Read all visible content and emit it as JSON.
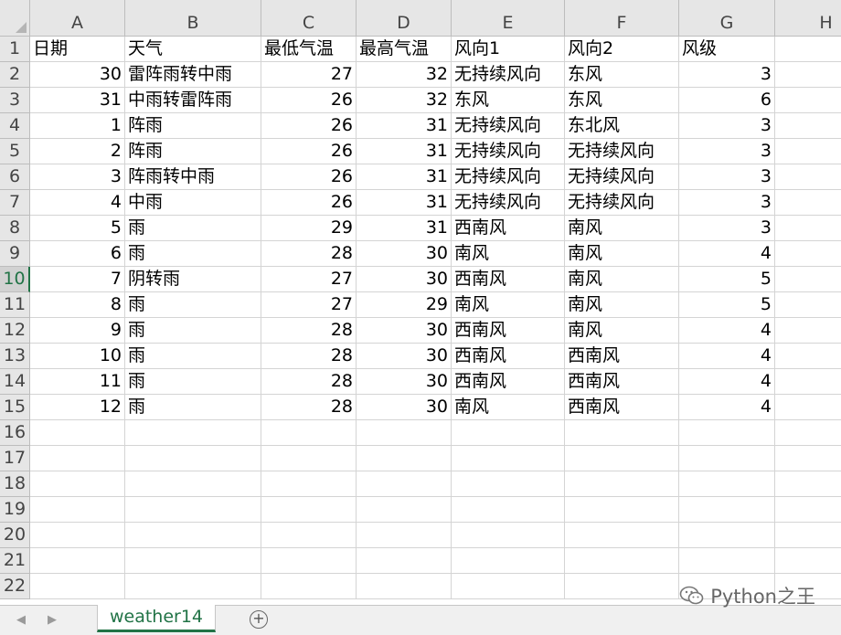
{
  "sheet": {
    "column_headers": [
      "A",
      "B",
      "C",
      "D",
      "E",
      "F",
      "G",
      "H"
    ],
    "row_count": 22,
    "active_row": 10,
    "header_row": [
      "日期",
      "天气",
      "最低气温",
      "最高气温",
      "风向1",
      "风向2",
      "风级"
    ],
    "rows": [
      [
        "30",
        "雷阵雨转中雨",
        "27",
        "32",
        "无持续风向",
        "东风",
        "3"
      ],
      [
        "31",
        "中雨转雷阵雨",
        "26",
        "32",
        "东风",
        "东风",
        "6"
      ],
      [
        "1",
        "阵雨",
        "26",
        "31",
        "无持续风向",
        "东北风",
        "3"
      ],
      [
        "2",
        "阵雨",
        "26",
        "31",
        "无持续风向",
        "无持续风向",
        "3"
      ],
      [
        "3",
        "阵雨转中雨",
        "26",
        "31",
        "无持续风向",
        "无持续风向",
        "3"
      ],
      [
        "4",
        "中雨",
        "26",
        "31",
        "无持续风向",
        "无持续风向",
        "3"
      ],
      [
        "5",
        "雨",
        "29",
        "31",
        "西南风",
        "南风",
        "3"
      ],
      [
        "6",
        "雨",
        "28",
        "30",
        "南风",
        "南风",
        "4"
      ],
      [
        "7",
        "阴转雨",
        "27",
        "30",
        "西南风",
        "南风",
        "5"
      ],
      [
        "8",
        "雨",
        "27",
        "29",
        "南风",
        "南风",
        "5"
      ],
      [
        "9",
        "雨",
        "28",
        "30",
        "西南风",
        "南风",
        "4"
      ],
      [
        "10",
        "雨",
        "28",
        "30",
        "西南风",
        "西南风",
        "4"
      ],
      [
        "11",
        "雨",
        "28",
        "30",
        "西南风",
        "西南风",
        "4"
      ],
      [
        "12",
        "雨",
        "28",
        "30",
        "南风",
        "西南风",
        "4"
      ]
    ],
    "numeric_columns": [
      0,
      2,
      3,
      6
    ]
  },
  "tabs": {
    "sheet_name": "weather14",
    "add_label": "+",
    "prev_icon": "triangle-left-icon",
    "next_icon": "triangle-right-icon"
  },
  "watermark": {
    "text": "Python之王",
    "icon": "wechat-icon"
  },
  "colors": {
    "accent": "#217346",
    "gridline": "#d4d4d4",
    "header_bg": "#e6e6e6"
  }
}
